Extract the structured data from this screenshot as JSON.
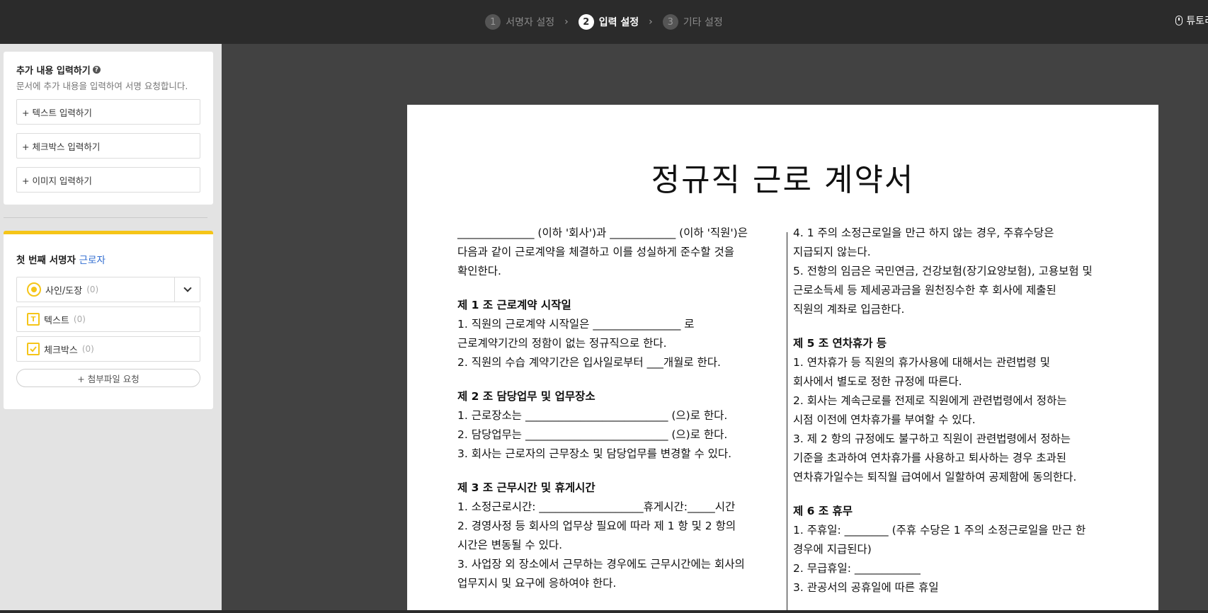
{
  "header": {
    "steps": [
      {
        "num": "1",
        "label": "서명자 설정"
      },
      {
        "num": "2",
        "label": "입력 설정"
      },
      {
        "num": "3",
        "label": "기타 설정"
      }
    ],
    "tutorial_label": "튜토리"
  },
  "panel": {
    "add_title": "추가 내용 입력하기",
    "add_desc": "문서에 추가 내용을 입력하여 서명 요청합니다.",
    "add_text": "+ 텍스트 입력하기",
    "add_checkbox": "+ 체크박스 입력하기",
    "add_image": "+ 이미지 입력하기",
    "signer_prefix": "첫 번째 서명자",
    "signer_role": "근로자",
    "fields": [
      {
        "label": "사인/도장",
        "count": "(0)"
      },
      {
        "label": "텍스트",
        "count": "(0)"
      },
      {
        "label": "체크박스",
        "count": "(0)"
      }
    ],
    "attach_label": "+ 첨부파일 요청"
  },
  "document": {
    "title": "정규직 근로 계약서",
    "left": {
      "intro": [
        "______________ (이하 '회사')과 ____________  (이하 '직원')은",
        "다음과 같이 근로계약을 체결하고 이를 성실하게 준수할 것을",
        "확인한다."
      ],
      "art1_title": "제 1 조 근로계약 시작일",
      "art1": [
        "1. 직원의 근로계약 시작일은 ________________  로",
        "근로계약기간의 정함이 없는 정규직으로 한다.",
        "2. 직원의 수습 계약기간은 입사일로부터  ___개월로 한다."
      ],
      "art2_title": "제 2 조 담당업무 및 업무장소",
      "art2": [
        "1. 근로장소는  __________________________  (으)로 한다.",
        "2. 담당업무는  __________________________  (으)로 한다.",
        "3. 회사는 근로자의 근무장소 및 담당업무를 변경할 수 있다."
      ],
      "art3_title": "제 3 조 근무시간 및 휴게시간",
      "art3": [
        "1. 소정근로시간: ___________________휴게시간:_____시간",
        "2. 경영사정 등 회사의 업무상 필요에 따라 제 1 항 및 2 항의",
        "시간은 변동될 수 있다.",
        "3. 사업장 외 장소에서 근무하는 경우에도 근무시간에는 회사의",
        "업무지시 및 요구에 응하여야 한다."
      ]
    },
    "right": {
      "cont": [
        "4. 1 주의 소정근로일을 만근 하지 않는 경우, 주휴수당은",
        "지급되지 않는다.",
        "5. 전항의 임금은 국민연금, 건강보험(장기요양보험), 고용보험 및",
        "근로소득세 등 제세공과금을 원천징수한 후 회사에 제출된",
        "직원의 계좌로 입금한다."
      ],
      "art5_title": "제 5 조 연차휴가 등",
      "art5": [
        "1. 연차휴가 등 직원의 휴가사용에 대해서는 관련법령 및",
        "회사에서 별도로 정한 규정에 따른다.",
        "2. 회사는 계속근로를 전제로 직원에게 관련법령에서 정하는",
        "시점 이전에 연차휴가를 부여할 수 있다.",
        "3. 제 2 항의 규정에도 불구하고 직원이 관련법령에서 정하는",
        "기준을 초과하여 연차휴가를 사용하고 퇴사하는 경우 초과된",
        "연차휴가일수는 퇴직월 급여에서 일할하여 공제함에 동의한다."
      ],
      "art6_title": "제 6 조 휴무",
      "art6": [
        "1. 주휴일: ________  (주휴 수당은 1 주의 소정근로일을 만근 한",
        "경우에 지급된다)",
        "2. 무급휴일: ____________",
        "3. 관공서의 공휴일에 따른 휴일"
      ]
    }
  },
  "colors": {
    "accent": "#f5c518",
    "signer_role": "#2e6bd0",
    "topbar": "#2b2b2b",
    "viewer": "#424242"
  }
}
